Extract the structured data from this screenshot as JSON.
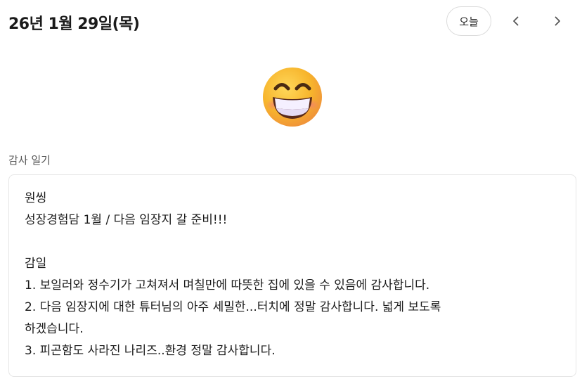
{
  "header": {
    "date": "26년 1월 29일(목)",
    "today_label": "오늘",
    "prev_icon": "chevron-left-icon",
    "next_icon": "chevron-right-icon"
  },
  "mood": {
    "emoji": "grinning-face-with-smiling-eyes"
  },
  "section": {
    "label": "감사 일기"
  },
  "entry": {
    "text": "원씽\n성장경험담 1월 / 다음 임장지 갈 준비!!!\n\n감일\n1. 보일러와 정수기가 고쳐져서 며칠만에 따뜻한 집에 있을 수 있음에 감사합니다.\n2. 다음 임장지에 대한 튜터님의 아주 세밀한...터치에 정말 감사합니다. 넓게 보도록\n하겠습니다.\n3. 피곤함도 사라진 나리즈..환경 정말 감사합니다."
  },
  "colors": {
    "border": "#e6e6e6",
    "text": "#1a1a1a",
    "label": "#555555",
    "emoji_face": "#f7b52c"
  }
}
